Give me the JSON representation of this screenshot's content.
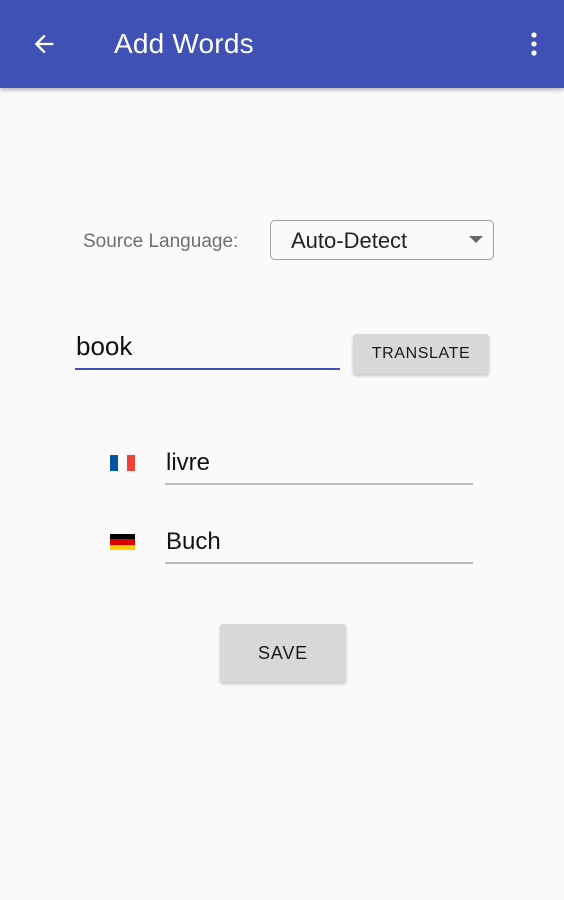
{
  "app_bar": {
    "title": "Add Words",
    "back_icon": "arrow-left-icon",
    "menu_icon": "more-vert-icon",
    "color": "#3f51b5"
  },
  "source_language": {
    "label": "Source Language:",
    "selected": "Auto-Detect"
  },
  "word_input": {
    "value": "book"
  },
  "translate_button": {
    "label": "TRANSLATE"
  },
  "translations": [
    {
      "flag_icon": "france-flag-icon",
      "value": "livre"
    },
    {
      "flag_icon": "germany-flag-icon",
      "value": "Buch"
    }
  ],
  "save_button": {
    "label": "SAVE"
  }
}
